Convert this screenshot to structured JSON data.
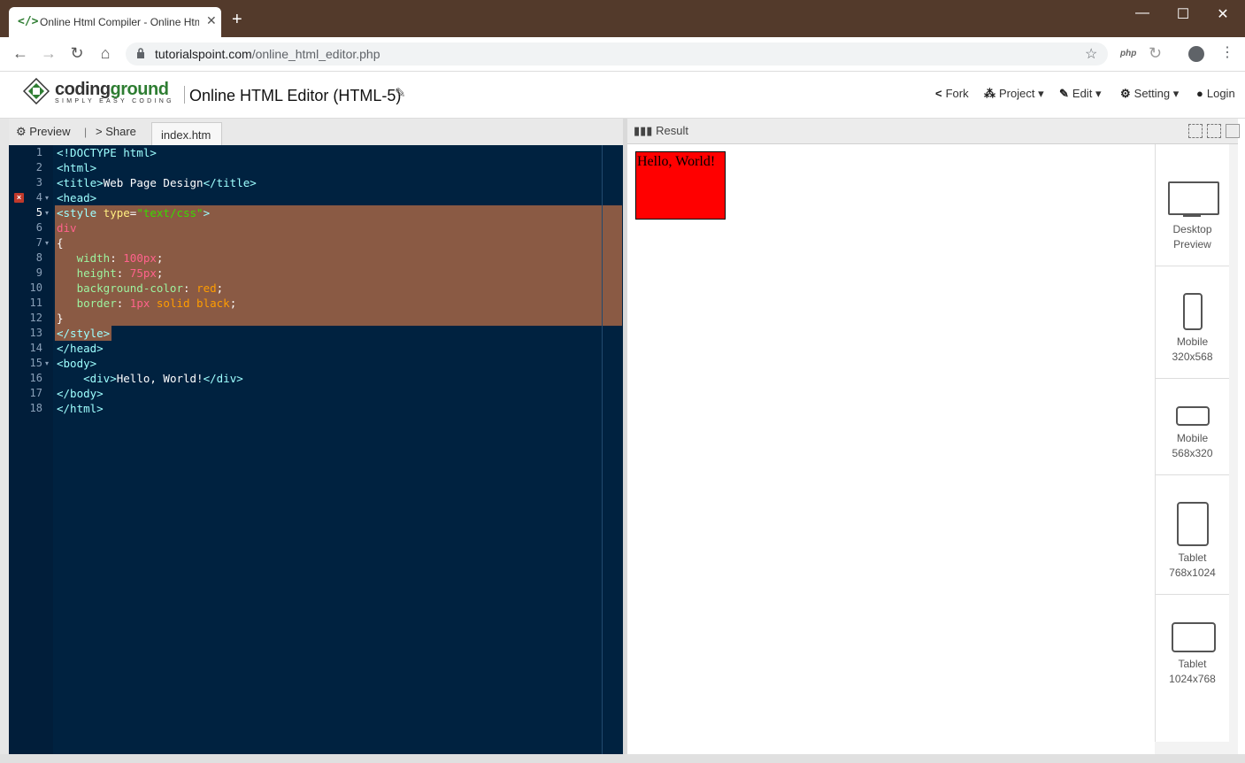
{
  "browser": {
    "tab_title": "Online Html Compiler - Online Html Editor",
    "tab_favicon": "</>",
    "url_host": "tutorialspoint.com",
    "url_path": "/online_html_editor.php",
    "ext_label": "php"
  },
  "app": {
    "logo_part1": "coding",
    "logo_part2": "ground",
    "logo_tagline": "SIMPLY EASY CODING",
    "page_title": "Online HTML Editor (HTML-5)",
    "nav": {
      "fork": "Fork",
      "project": "Project",
      "edit": "Edit",
      "setting": "Setting",
      "login": "Login"
    }
  },
  "editor": {
    "preview_label": "Preview",
    "separator": "|",
    "share_label": "Share",
    "file_tab": "index.htm",
    "error_line": 4,
    "lines": [
      "1",
      "2",
      "3",
      "4",
      "5",
      "6",
      "7",
      "8",
      "9",
      "10",
      "11",
      "12",
      "13",
      "14",
      "15",
      "16",
      "17",
      "18"
    ]
  },
  "result": {
    "label": "Result",
    "hello_text": "Hello, World!",
    "devices": [
      {
        "name": "Desktop",
        "size": "Preview"
      },
      {
        "name": "Mobile",
        "size": "320x568"
      },
      {
        "name": "Mobile",
        "size": "568x320"
      },
      {
        "name": "Tablet",
        "size": "768x1024"
      },
      {
        "name": "Tablet",
        "size": "1024x768"
      }
    ]
  },
  "colors": {
    "titlebar": "#533a2b",
    "editor_bg": "#002240",
    "selection": "#8a5a44",
    "result_box": "#ff0000",
    "brand_green": "#2e7d32"
  },
  "icons": [
    "back-arrow-icon",
    "forward-arrow-icon",
    "reload-icon",
    "home-icon",
    "lock-icon",
    "star-icon",
    "account-icon",
    "more-icon",
    "fork-icon",
    "project-icon",
    "edit-icon",
    "gear-icon",
    "user-icon",
    "bar-chart-icon",
    "desktop-icon",
    "mobile-portrait-icon",
    "mobile-landscape-icon",
    "tablet-portrait-icon",
    "tablet-landscape-icon"
  ]
}
